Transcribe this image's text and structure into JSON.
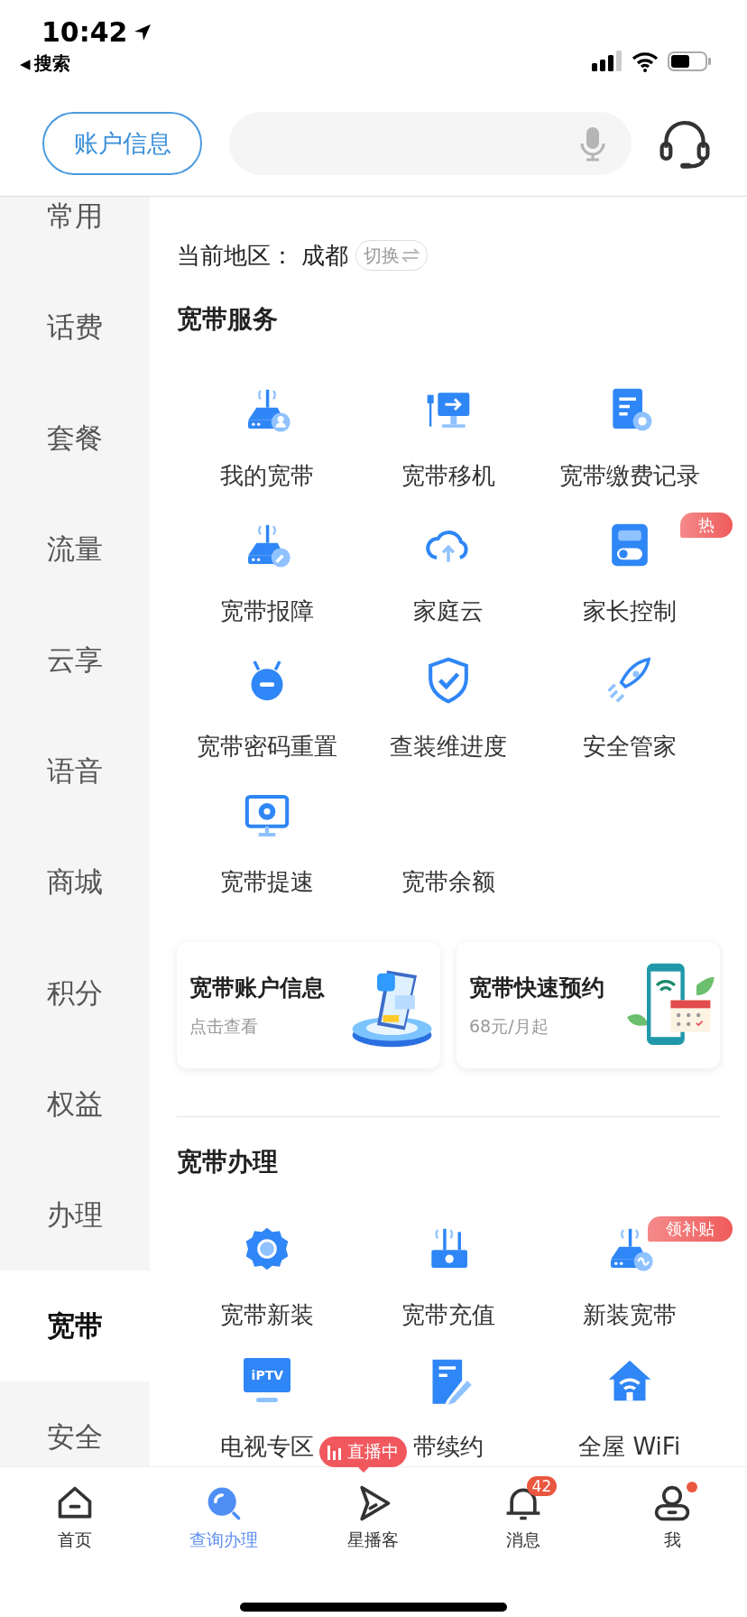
{
  "status_bar": {
    "time": "10:42",
    "back_glyph": "◀",
    "back_label": "搜索"
  },
  "header": {
    "account_button": "账户信息"
  },
  "sidebar": {
    "items": [
      {
        "label": "常用",
        "selected": false
      },
      {
        "label": "话费",
        "selected": false
      },
      {
        "label": "套餐",
        "selected": false
      },
      {
        "label": "流量",
        "selected": false
      },
      {
        "label": "云享",
        "selected": false
      },
      {
        "label": "语音",
        "selected": false
      },
      {
        "label": "商城",
        "selected": false
      },
      {
        "label": "积分",
        "selected": false
      },
      {
        "label": "权益",
        "selected": false
      },
      {
        "label": "办理",
        "selected": false
      },
      {
        "label": "宽带",
        "selected": true
      },
      {
        "label": "安全",
        "selected": false
      }
    ]
  },
  "region": {
    "label": "当前地区：",
    "city": "成都",
    "switch_label": "切换"
  },
  "broadband_services": {
    "title": "宽带服务",
    "items": [
      {
        "label": "我的宽带"
      },
      {
        "label": "宽带移机"
      },
      {
        "label": "宽带缴费记录"
      },
      {
        "label": "宽带报障"
      },
      {
        "label": "家庭云"
      },
      {
        "label": "家长控制",
        "badge": "热"
      },
      {
        "label": "宽带密码重置"
      },
      {
        "label": "查装维进度"
      },
      {
        "label": "安全管家"
      },
      {
        "label": "宽带提速"
      },
      {
        "label": "宽带余额"
      }
    ]
  },
  "cards": [
    {
      "title": "宽带账户信息",
      "subtitle": "点击查看"
    },
    {
      "title": "宽带快速预约",
      "subtitle": "68元/月起"
    }
  ],
  "broadband_handling": {
    "title": "宽带办理",
    "items": [
      {
        "label": "宽带新装"
      },
      {
        "label": "宽带充值"
      },
      {
        "label": "新装宽带",
        "badge": "领补贴"
      },
      {
        "label": "电视专区",
        "icon_text": "iPTV"
      },
      {
        "label": "带续约"
      },
      {
        "label": "全屋 WiFi"
      }
    ]
  },
  "live_badge": "直播中",
  "tab_bar": {
    "items": [
      {
        "label": "首页",
        "selected": false,
        "dot": false
      },
      {
        "label": "查询办理",
        "selected": true,
        "dot": false
      },
      {
        "label": "星播客",
        "selected": false,
        "dot": false
      },
      {
        "label": "消息",
        "selected": false,
        "dot": false,
        "count": "42"
      },
      {
        "label": "我",
        "selected": false,
        "dot": true
      }
    ]
  }
}
